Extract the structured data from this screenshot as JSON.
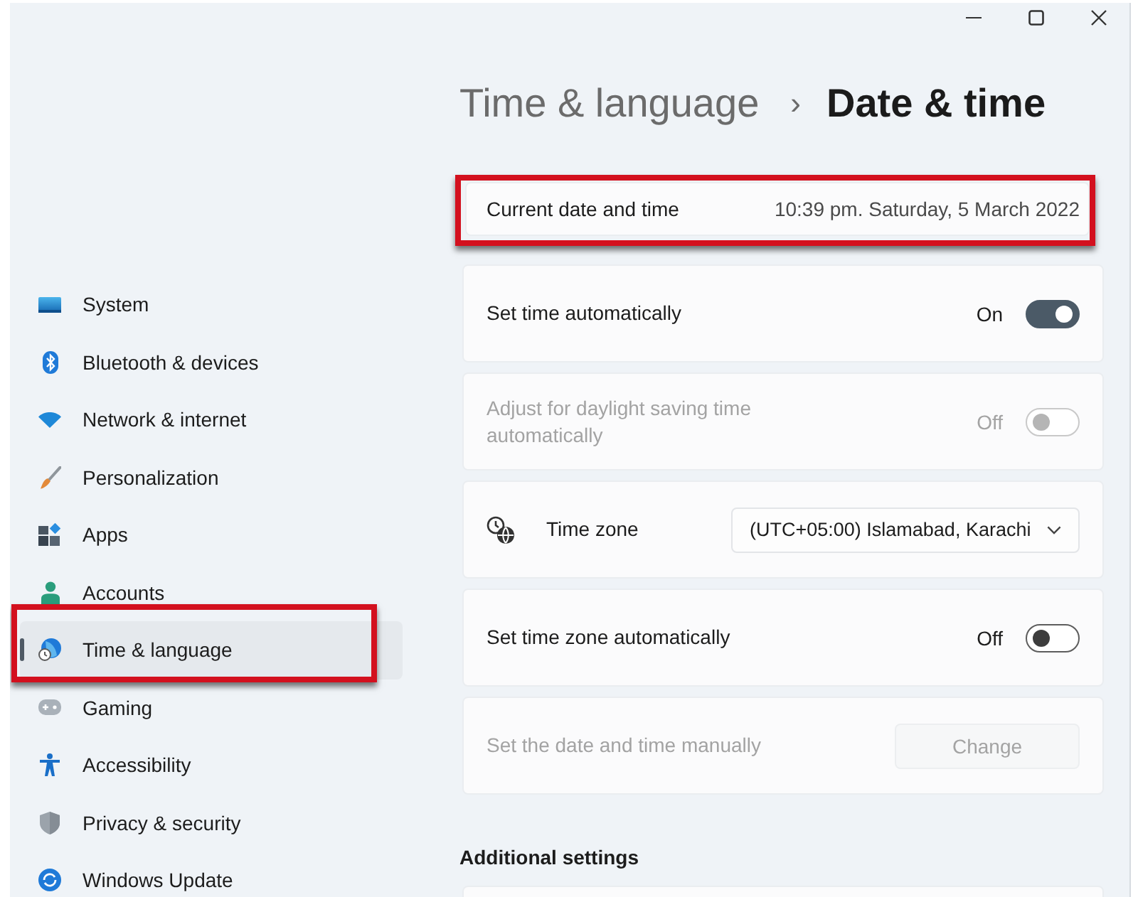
{
  "breadcrumb": {
    "parent": "Time & language",
    "separator": "›",
    "current": "Date & time"
  },
  "sidebar": {
    "items": [
      {
        "label": "System",
        "selected": false,
        "highlighted": false
      },
      {
        "label": "Bluetooth & devices",
        "selected": false,
        "highlighted": false
      },
      {
        "label": "Network & internet",
        "selected": false,
        "highlighted": false
      },
      {
        "label": "Personalization",
        "selected": false,
        "highlighted": false
      },
      {
        "label": "Apps",
        "selected": false,
        "highlighted": false
      },
      {
        "label": "Accounts",
        "selected": false,
        "highlighted": false
      },
      {
        "label": "Time & language",
        "selected": true,
        "highlighted": true
      },
      {
        "label": "Gaming",
        "selected": false,
        "highlighted": false
      },
      {
        "label": "Accessibility",
        "selected": false,
        "highlighted": false
      },
      {
        "label": "Privacy & security",
        "selected": false,
        "highlighted": false
      },
      {
        "label": "Windows Update",
        "selected": false,
        "highlighted": false
      }
    ]
  },
  "settings": [
    {
      "kind": "info",
      "label": "Current date and time",
      "value": "10:39 pm. Saturday, 5 March 2022",
      "highlighted": true,
      "disabled": false
    },
    {
      "kind": "toggle",
      "label": "Set time automatically",
      "state_label": "On",
      "on": true,
      "highlighted": false,
      "disabled": false
    },
    {
      "kind": "toggle",
      "label": "Adjust for daylight saving time automatically",
      "state_label": "Off",
      "on": false,
      "highlighted": false,
      "disabled": true
    },
    {
      "kind": "dropdown",
      "label": "Time zone",
      "value": "(UTC+05:00) Islamabad, Karachi",
      "highlighted": false,
      "disabled": false
    },
    {
      "kind": "toggle",
      "label": "Set time zone automatically",
      "state_label": "Off",
      "on": false,
      "highlighted": false,
      "disabled": false
    },
    {
      "kind": "button",
      "label": "Set the date and time manually",
      "button": "Change",
      "highlighted": false,
      "disabled": true
    }
  ],
  "additional_settings": {
    "title": "Additional settings"
  }
}
